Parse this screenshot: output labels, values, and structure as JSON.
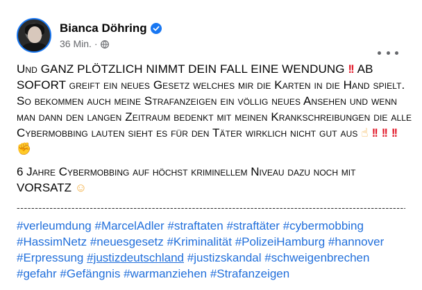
{
  "post": {
    "author": "Bianca Döhring",
    "time": "36 Min.",
    "separator": "·",
    "text_p1_a": "Und GANZ PLÖTZLICH NIMMT DEIN FALL EINE WENDUNG",
    "text_p1_b": "AB SOFORT greift ein neues Gesetz welches mir die Karten in die Hand spielt. So bekommen auch meine Strafanzeigen ein völlig neues Ansehen und wenn man dann den langen Zeitraum bedenkt mit meinen Krankschreibungen die alle Cybermobbing lauten sieht es für den Täter wirklich nicht gut aus",
    "text_p2": "6 Jahre Cybermobbing auf höchst kriminellem Niveau dazu noch mit VORSATZ",
    "divider": "----------------------------------------------------------------------------------------------------------------",
    "hashtags": [
      "#verleumdung",
      "#MarcelAdler",
      "#straftaten",
      "#straftäter",
      "#cybermobbing",
      "#HassimNetz",
      "#neuesgesetz",
      "#Kriminalität",
      "#PolizeiHamburg",
      "#hannover",
      "#Erpressung",
      "#justizdeutschland",
      "#justizskandal",
      "#schweigenbrechen",
      "#gefahr",
      "#Gefängnis",
      "#warmanziehen",
      "#Strafanzeigen"
    ]
  },
  "icons": {
    "verified": "verified-badge-icon",
    "globe": "globe-icon",
    "more": "more-options-icon",
    "emoji_double_bang": "double-exclamation-icon",
    "emoji_point_up": "point-up-icon",
    "emoji_fist": "fist-icon",
    "emoji_thinking": "thinking-face-icon"
  },
  "colors": {
    "link": "#216fdb",
    "verified": "#1877f2",
    "secondary": "#65676b",
    "exclamation": "#e21b2b"
  }
}
